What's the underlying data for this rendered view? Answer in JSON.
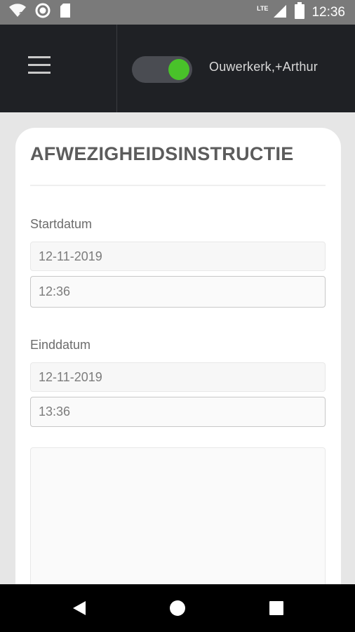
{
  "status_bar": {
    "time": "12:36",
    "network": "LTE",
    "icons": [
      "wifi-question-icon",
      "circle-status-icon",
      "sd-card-icon",
      "signal-icon",
      "battery-icon"
    ]
  },
  "header": {
    "menu_icon": "hamburger-menu-icon",
    "toggle_on": true,
    "toggle_color": "#49c22a",
    "user_name": "Ouwerkerk,+Arthur"
  },
  "form": {
    "title": "AFWEZIGHEIDSINSTRUCTIE",
    "start": {
      "label": "Startdatum",
      "date": "12-11-2019",
      "time": "12:36"
    },
    "end": {
      "label": "Einddatum",
      "date": "12-11-2019",
      "time": "13:36"
    },
    "instruction_text": ""
  },
  "nav_bar": {
    "buttons": [
      "back-icon",
      "home-icon",
      "recents-icon"
    ]
  }
}
